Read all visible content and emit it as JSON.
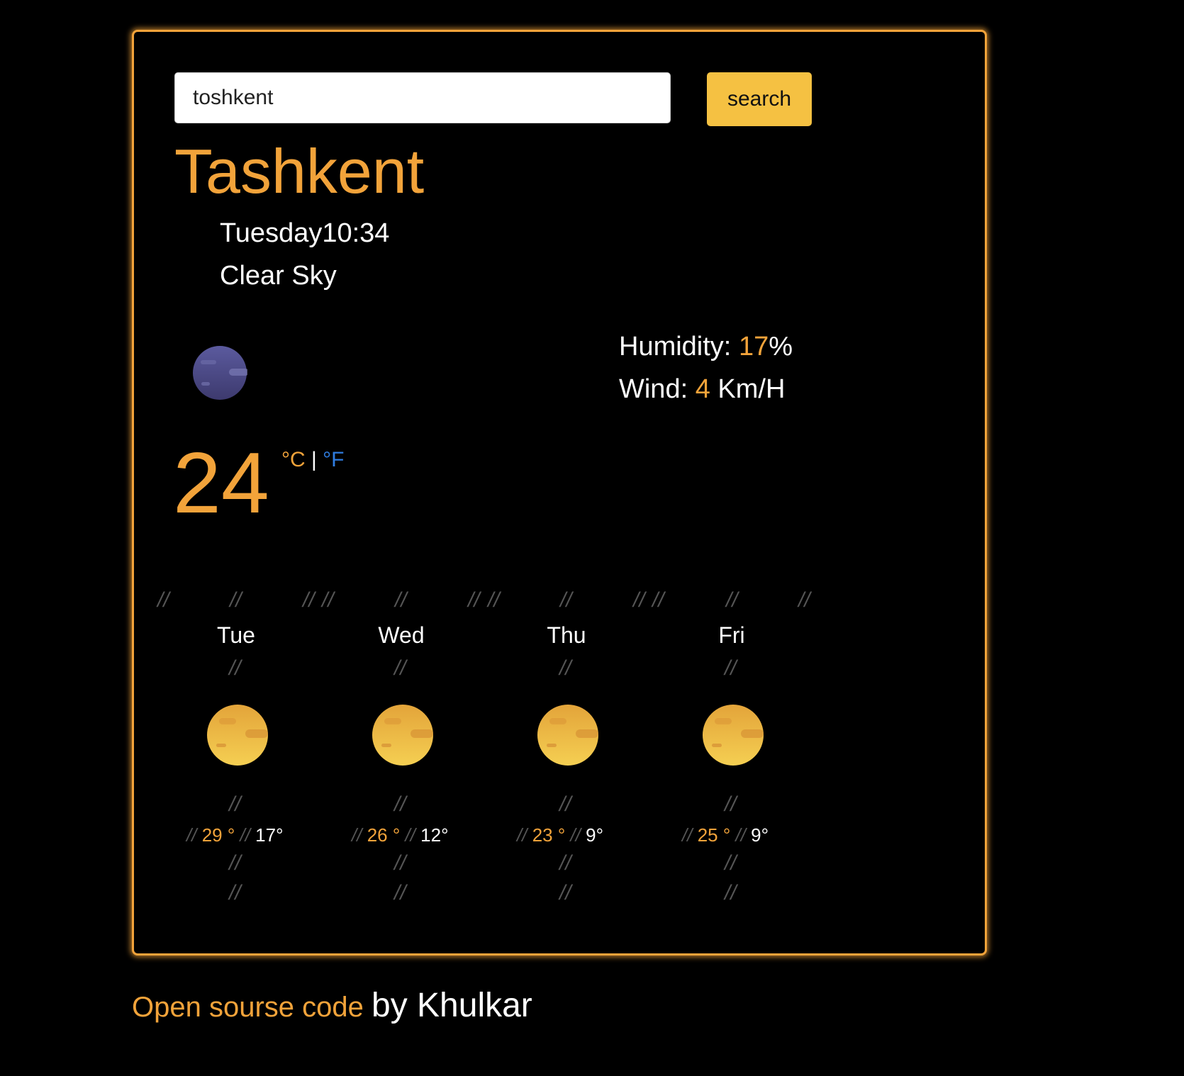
{
  "search": {
    "value": "toshkent",
    "button_label": "search"
  },
  "current": {
    "city": "Tashkent",
    "datetime": "Tuesday10:34",
    "description": "Clear Sky",
    "icon": "night-clear-moon-icon",
    "temperature": "24",
    "unit_celsius": "°C",
    "unit_separator": "|",
    "unit_fahrenheit": "°F",
    "humidity_label": "Humidity:",
    "humidity_value": "17",
    "humidity_unit": "%",
    "wind_label": "Wind:",
    "wind_value": "4",
    "wind_unit": "Km/H"
  },
  "decor": {
    "slash": "//"
  },
  "forecast": [
    {
      "day": "Tue",
      "icon": "sun-icon",
      "max": "29 °",
      "min": "17°"
    },
    {
      "day": "Wed",
      "icon": "sun-icon",
      "max": "26 °",
      "min": "12°"
    },
    {
      "day": "Thu",
      "icon": "sun-icon",
      "max": "23 °",
      "min": "9°"
    },
    {
      "day": "Fri",
      "icon": "sun-icon",
      "max": "25 °",
      "min": "9°"
    }
  ],
  "footer": {
    "link_text": "Open sourse code",
    "author_text": "by Khulkar"
  },
  "colors": {
    "accent": "#f2a33a",
    "button": "#f5c142",
    "fahrenheit": "#2f7de1",
    "background": "#000000"
  }
}
